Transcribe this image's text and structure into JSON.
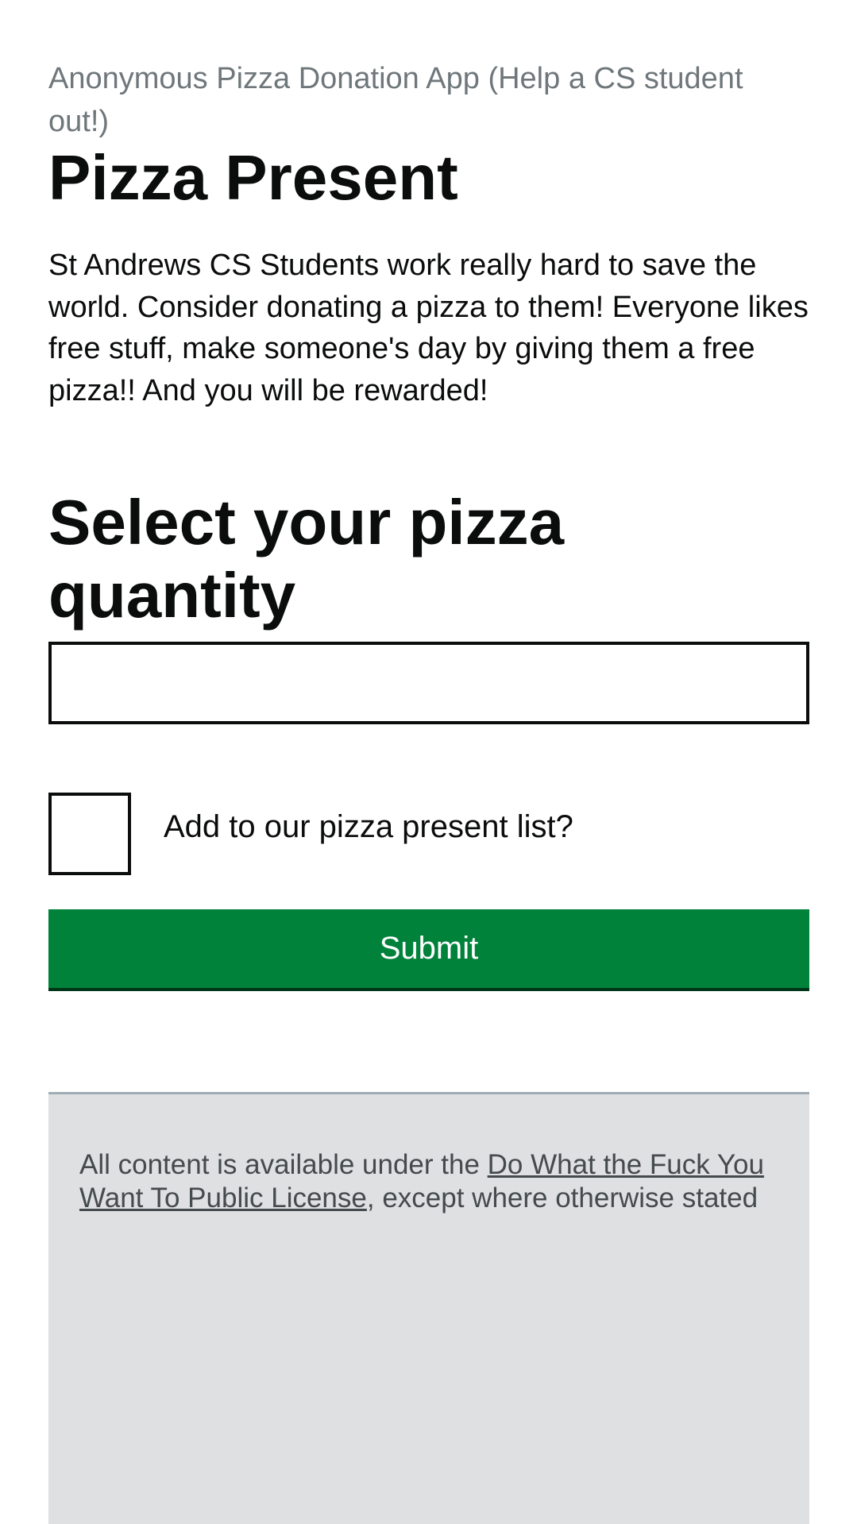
{
  "header": {
    "caption": "Anonymous Pizza Donation App (Help a CS student out!)",
    "title": "Pizza Present"
  },
  "intro": {
    "text": "St Andrews CS Students work really hard to save the world. Consider donating a pizza to them! Everyone likes free stuff, make someone's day by giving them a free pizza!! And you will be rewarded!"
  },
  "form": {
    "quantity_heading": "Select your pizza quantity",
    "quantity_value": "",
    "checkbox_label": "Add to our pizza present list?",
    "checkbox_checked": false,
    "submit_label": "Submit"
  },
  "footer": {
    "text_before": "All content is available under the ",
    "license_link": "Do What the Fuck You Want To Public License",
    "text_after": ", except where otherwise stated"
  },
  "colors": {
    "button": "#00823b",
    "button_shadow": "#003618",
    "caption": "#6f777b",
    "footer_bg": "#dee0e2",
    "footer_border": "#a1acb2",
    "text": "#0b0c0c"
  }
}
